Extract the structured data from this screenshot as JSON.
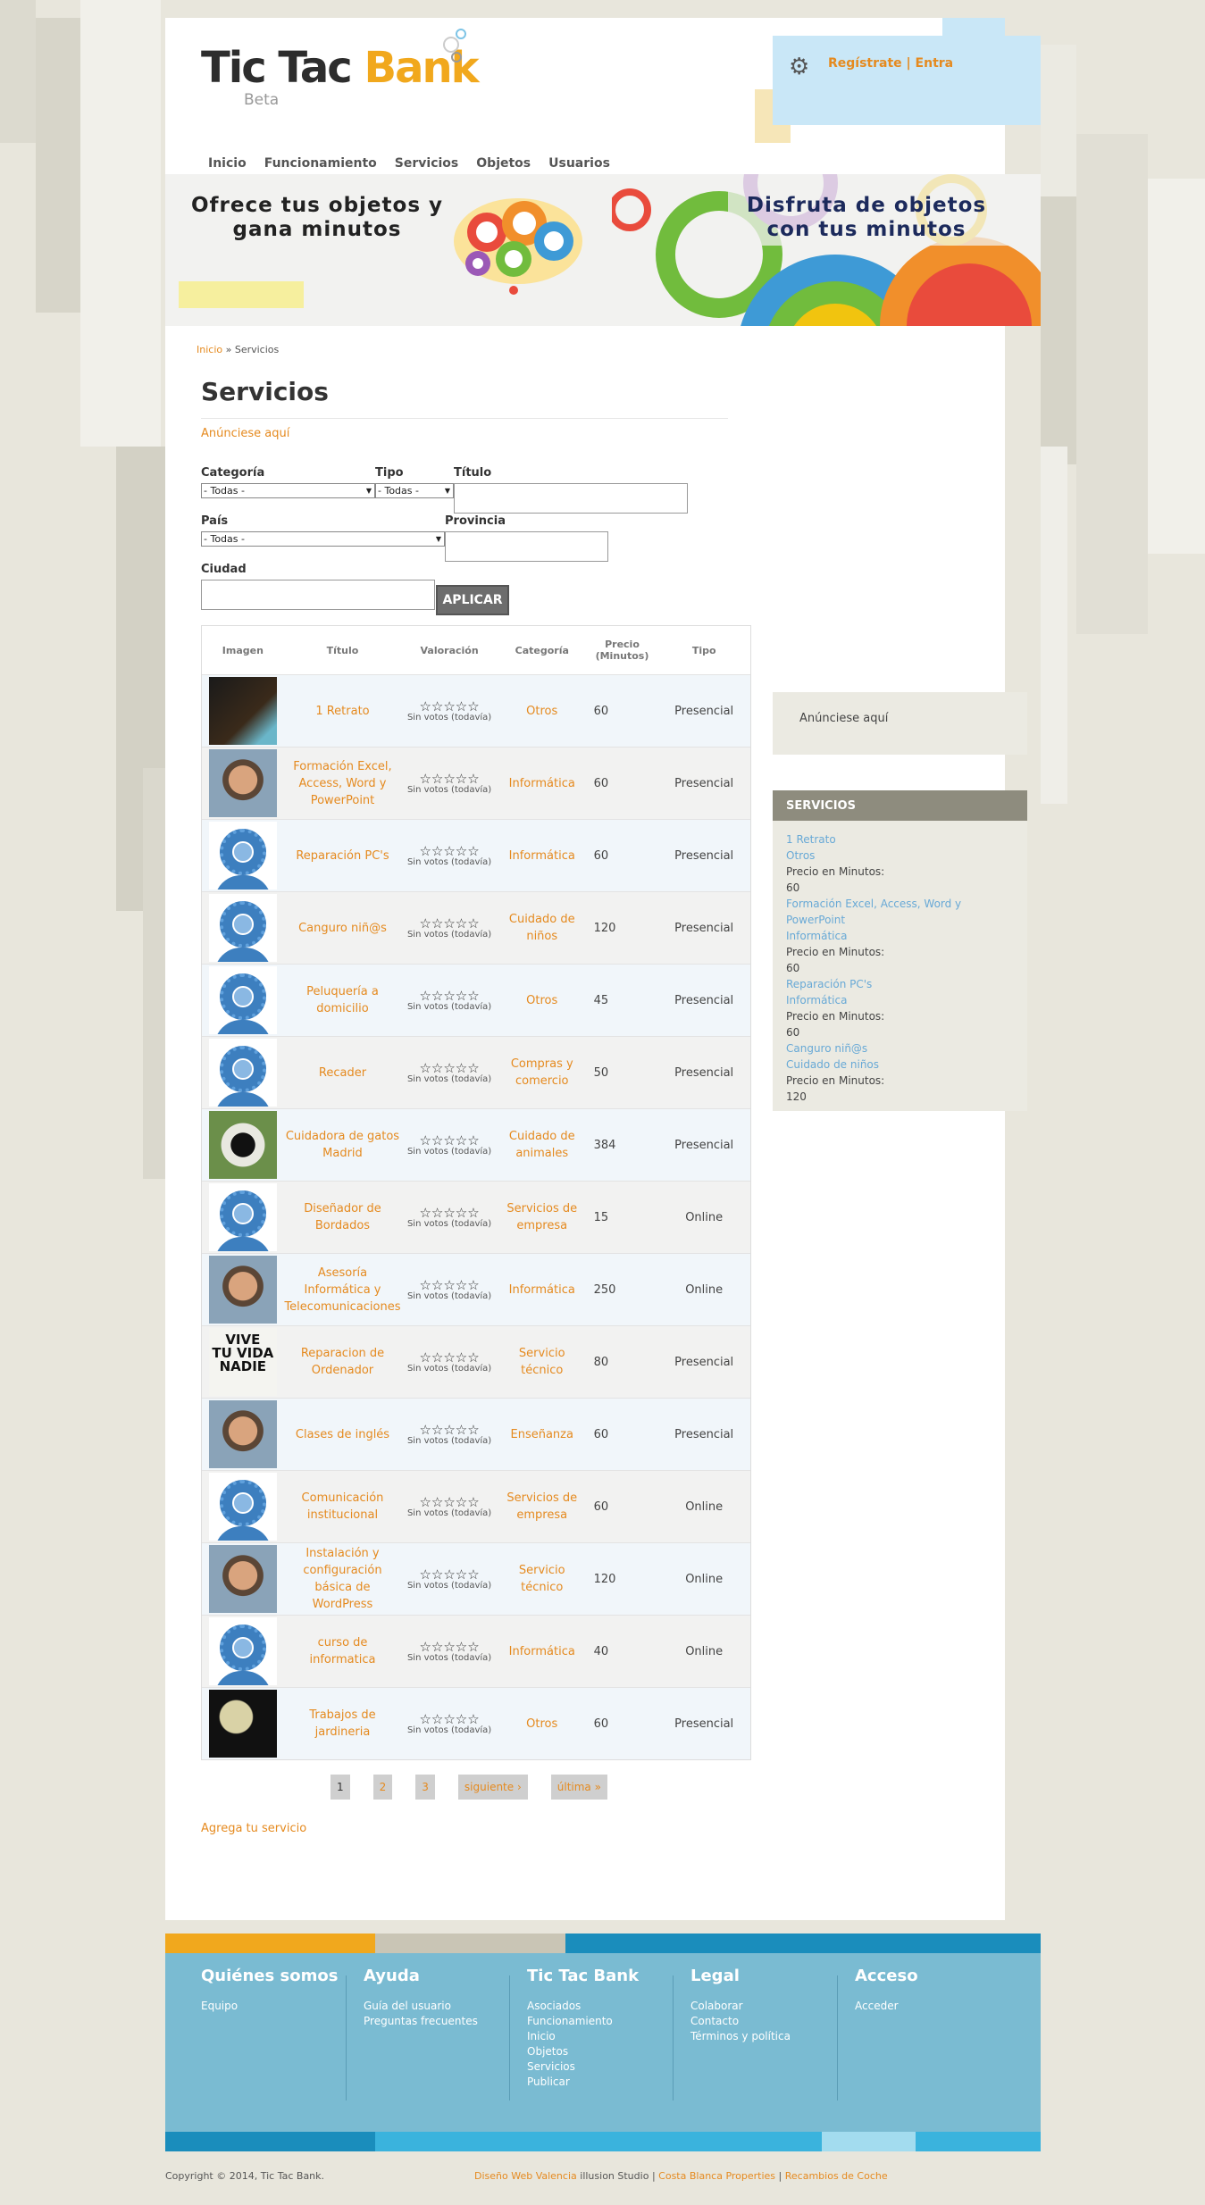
{
  "brand": {
    "name_1": "Tic Tac",
    "name_2": "Bank",
    "tag": "Beta"
  },
  "account": {
    "register": "Regístrate",
    "sep": "|",
    "login": "Entra"
  },
  "nav": [
    "Inicio",
    "Funcionamiento",
    "Servicios",
    "Objetos",
    "Usuarios"
  ],
  "banner": {
    "left_1": "Ofrece tus objetos y",
    "left_2": "gana minutos",
    "right_1": "Disfruta de objetos",
    "right_2": "con tus minutos"
  },
  "breadcrumb": {
    "home": "Inicio",
    "sep": "»",
    "current": "Servicios"
  },
  "page": {
    "title": "Servicios",
    "ad_link": "Anúnciese aquí"
  },
  "filters": {
    "category_label": "Categoría",
    "category_value": "- Todas -",
    "type_label": "Tipo",
    "type_value": "- Todas -",
    "title_label": "Título",
    "country_label": "País",
    "country_value": "- Todas -",
    "province_label": "Provincia",
    "city_label": "Ciudad",
    "apply": "APLICAR"
  },
  "table": {
    "headers": [
      "Imagen",
      "Título",
      "Valoración",
      "Categoría",
      "Precio (Minutos)",
      "Tipo"
    ],
    "stars": "☆☆☆☆☆",
    "no_votes": "Sin votos (todavía)",
    "rows": [
      {
        "title": "1 Retrato",
        "category": "Otros",
        "price": "60",
        "type": "Presencial",
        "img": "dark"
      },
      {
        "title": "Formación Excel, Access, Word y PowerPoint",
        "category": "Informática",
        "price": "60",
        "type": "Presencial",
        "img": "face"
      },
      {
        "title": "Reparación PC's",
        "category": "Informática",
        "price": "60",
        "type": "Presencial",
        "img": "default"
      },
      {
        "title": "Canguro niñ@s",
        "category": "Cuidado de niños",
        "price": "120",
        "type": "Presencial",
        "img": "default"
      },
      {
        "title": "Peluquería a domicilio",
        "category": "Otros",
        "price": "45",
        "type": "Presencial",
        "img": "default"
      },
      {
        "title": "Recader",
        "category": "Compras y comercio",
        "price": "50",
        "type": "Presencial",
        "img": "default"
      },
      {
        "title": "Cuidadora de gatos Madrid",
        "category": "Cuidado de animales",
        "price": "384",
        "type": "Presencial",
        "img": "cat"
      },
      {
        "title": "Diseñador de Bordados",
        "category": "Servicios de empresa",
        "price": "15",
        "type": "Online",
        "img": "default"
      },
      {
        "title": "Asesoría Informática y Telecomunicaciones",
        "category": "Informática",
        "price": "250",
        "type": "Online",
        "img": "face"
      },
      {
        "title": "Reparacion de Ordenador",
        "category": "Servicio técnico",
        "price": "80",
        "type": "Presencial",
        "img": "vive"
      },
      {
        "title": "Clases de inglés",
        "category": "Enseñanza",
        "price": "60",
        "type": "Presencial",
        "img": "face"
      },
      {
        "title": "Comunicación institucional",
        "category": "Servicios de empresa",
        "price": "60",
        "type": "Online",
        "img": "default"
      },
      {
        "title": "Instalación y configuración básica de WordPress",
        "category": "Servicio técnico",
        "price": "120",
        "type": "Online",
        "img": "face"
      },
      {
        "title": "curso de informatica",
        "category": "Informática",
        "price": "40",
        "type": "Online",
        "img": "default"
      },
      {
        "title": "Trabajos de jardineria",
        "category": "Otros",
        "price": "60",
        "type": "Presencial",
        "img": "moon"
      }
    ]
  },
  "pager": {
    "p1": "1",
    "p2": "2",
    "p3": "3",
    "next": "siguiente ›",
    "last": "última »"
  },
  "add_service": "Agrega tu servicio",
  "sidebar": {
    "ad": "Anúnciese aquí",
    "heading": "SERVICIOS",
    "price_label": "Precio en Minutos:",
    "items": [
      {
        "title": "1 Retrato",
        "category": "Otros",
        "price": "60"
      },
      {
        "title": "Formación Excel, Access, Word y PowerPoint",
        "category": "Informática",
        "price": "60"
      },
      {
        "title": "Reparación PC's",
        "category": "Informática",
        "price": "60"
      },
      {
        "title": "Canguro niñ@s",
        "category": "Cuidado de niños",
        "price": "120"
      }
    ]
  },
  "footer": {
    "cols": [
      {
        "title": "Quiénes somos",
        "links": [
          "Equipo"
        ]
      },
      {
        "title": "Ayuda",
        "links": [
          "Guía del usuario",
          "Preguntas frecuentes"
        ]
      },
      {
        "title": "Tic Tac Bank",
        "links": [
          "Asociados",
          "Funcionamiento",
          "Inicio",
          "Objetos",
          "Servicios",
          "Publicar"
        ]
      },
      {
        "title": "Legal",
        "links": [
          "Colaborar",
          "Contacto",
          "Términos y política"
        ]
      },
      {
        "title": "Acceso",
        "links": [
          "Acceder"
        ]
      }
    ],
    "copyright": "Copyright © 2014, Tic Tac Bank.",
    "credit_1": "Diseño Web Valencia",
    "credit_2": "illusion Studio",
    "sep": "|",
    "credit_3": "Costa Blanca Properties",
    "credit_4": "Recambios de Coche"
  },
  "colors": {
    "accent": "#e58a1f",
    "brand_yellow": "#f1a81d",
    "footer": "#7abbd2",
    "sidebar_head": "#8e8c7e"
  }
}
